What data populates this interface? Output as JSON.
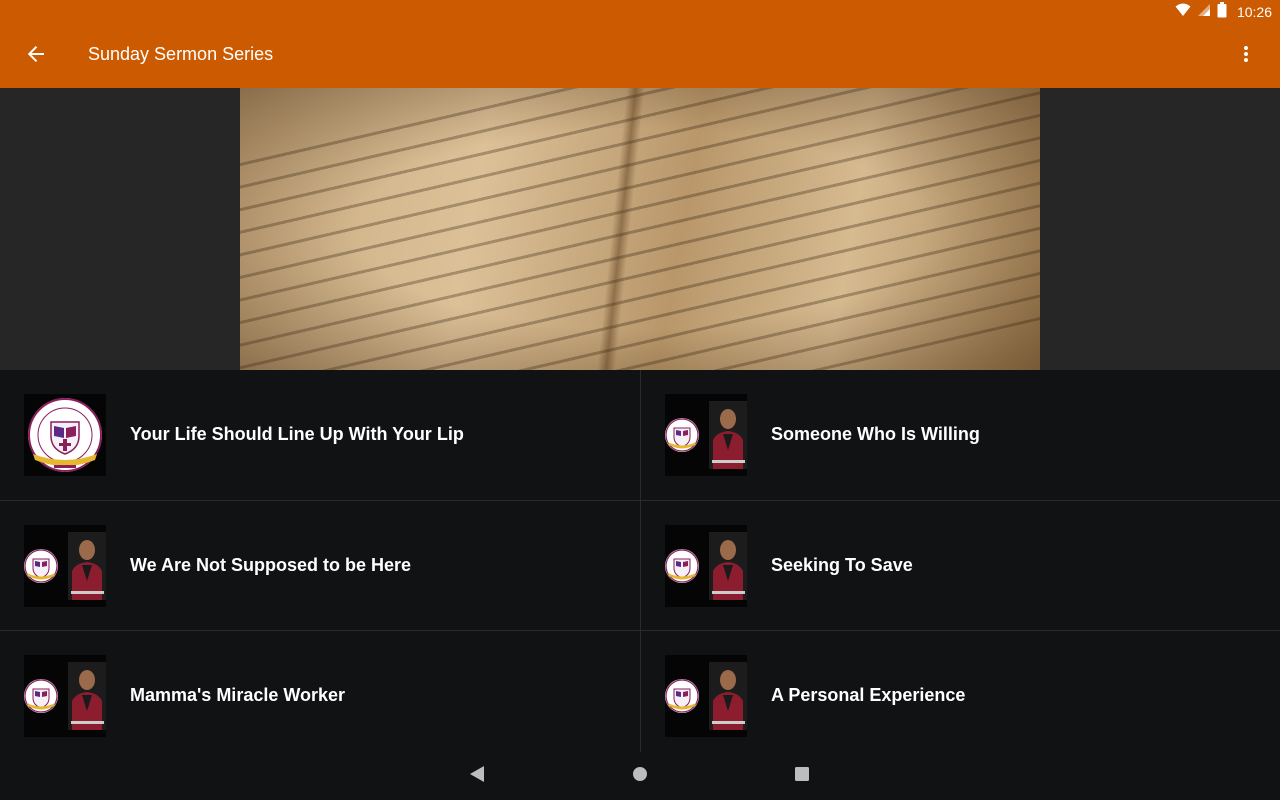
{
  "status": {
    "time": "10:26",
    "icons": [
      "wifi-icon",
      "cell-signal-icon",
      "battery-icon"
    ]
  },
  "appbar": {
    "title": "Sunday Sermon Series",
    "back_icon": "arrow-back-icon",
    "menu_icon": "more-vert-icon"
  },
  "hero": {
    "image": "open-bible-photo"
  },
  "sermons": [
    {
      "title": "Your Life Should Line Up With Your Lip",
      "thumbnail": "church-logo"
    },
    {
      "title": "Someone Who Is Willing",
      "thumbnail": "logo-and-pastor"
    },
    {
      "title": "We Are Not Supposed to be Here",
      "thumbnail": "logo-and-pastor"
    },
    {
      "title": "Seeking To Save",
      "thumbnail": "logo-and-pastor"
    },
    {
      "title": "Mamma's Miracle Worker",
      "thumbnail": "logo-and-pastor"
    },
    {
      "title": "A Personal Experience",
      "thumbnail": "logo-and-pastor"
    }
  ],
  "navigation": [
    "back-triangle-icon",
    "home-circle-icon",
    "recents-square-icon"
  ],
  "colors": {
    "appbar": "#cc5a00",
    "background": "#111214",
    "hero_surround": "#262626",
    "text": "#ffffff"
  }
}
